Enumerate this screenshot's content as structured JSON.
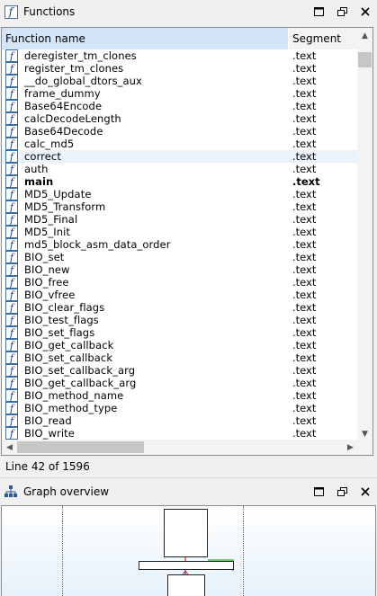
{
  "functions_panel": {
    "title": "Functions",
    "icon": "function-icon",
    "columns": {
      "name": "Function name",
      "segment": "Segment"
    },
    "rows": [
      {
        "name": "deregister_tm_clones",
        "segment": ".text"
      },
      {
        "name": "register_tm_clones",
        "segment": ".text"
      },
      {
        "name": "__do_global_dtors_aux",
        "segment": ".text"
      },
      {
        "name": "frame_dummy",
        "segment": ".text"
      },
      {
        "name": "Base64Encode",
        "segment": ".text"
      },
      {
        "name": "calcDecodeLength",
        "segment": ".text"
      },
      {
        "name": "Base64Decode",
        "segment": ".text"
      },
      {
        "name": "calc_md5",
        "segment": ".text"
      },
      {
        "name": "correct",
        "segment": ".text",
        "selected": true
      },
      {
        "name": "auth",
        "segment": ".text"
      },
      {
        "name": "main",
        "segment": ".text",
        "bold": true
      },
      {
        "name": "MD5_Update",
        "segment": ".text"
      },
      {
        "name": "MD5_Transform",
        "segment": ".text"
      },
      {
        "name": "MD5_Final",
        "segment": ".text"
      },
      {
        "name": "MD5_Init",
        "segment": ".text"
      },
      {
        "name": "md5_block_asm_data_order",
        "segment": ".text"
      },
      {
        "name": "BIO_set",
        "segment": ".text"
      },
      {
        "name": "BIO_new",
        "segment": ".text"
      },
      {
        "name": "BIO_free",
        "segment": ".text"
      },
      {
        "name": "BIO_vfree",
        "segment": ".text"
      },
      {
        "name": "BIO_clear_flags",
        "segment": ".text"
      },
      {
        "name": "BIO_test_flags",
        "segment": ".text"
      },
      {
        "name": "BIO_set_flags",
        "segment": ".text"
      },
      {
        "name": "BIO_get_callback",
        "segment": ".text"
      },
      {
        "name": "BIO_set_callback",
        "segment": ".text"
      },
      {
        "name": "BIO_set_callback_arg",
        "segment": ".text"
      },
      {
        "name": "BIO_get_callback_arg",
        "segment": ".text"
      },
      {
        "name": "BIO_method_name",
        "segment": ".text"
      },
      {
        "name": "BIO_method_type",
        "segment": ".text"
      },
      {
        "name": "BIO_read",
        "segment": ".text"
      },
      {
        "name": "BIO_write",
        "segment": ".text"
      }
    ],
    "status": "Line 42 of 1596"
  },
  "graph_panel": {
    "title": "Graph overview",
    "icon": "graph-tree-icon"
  },
  "window_buttons": {
    "maximize": "maximize-icon",
    "restore": "restore-icon",
    "close": "close-icon"
  },
  "colors": {
    "header_selected": "#d4e5f7",
    "selected_row": "#eaf2fb",
    "graph_edge_green": "#2e9e2e",
    "graph_edge_red": "#d03030",
    "graph_edge_blue": "#2040c0"
  }
}
